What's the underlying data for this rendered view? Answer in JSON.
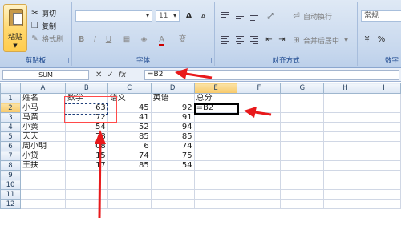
{
  "ribbon": {
    "clipboard": {
      "paste_label": "粘贴",
      "cut_label": "剪切",
      "copy_label": "复制",
      "format_painter_label": "格式刷",
      "group_label": "剪贴板"
    },
    "font": {
      "font_name": "",
      "font_size": "11",
      "grow_font": "A",
      "shrink_font": "A",
      "bold": "B",
      "italic": "I",
      "underline": "U",
      "font_color": "A",
      "phonetic": "变",
      "group_label": "字体"
    },
    "alignment": {
      "wrap_text_label": "自动换行",
      "merge_center_label": "合并后居中",
      "group_label": "对齐方式"
    },
    "number": {
      "format_value": "常规",
      "group_label": "数字"
    }
  },
  "formula_bar": {
    "name_box": "SUM",
    "cancel": "✕",
    "enter": "✓",
    "fx": "fx",
    "formula": "=B2"
  },
  "grid": {
    "columns": [
      "A",
      "B",
      "C",
      "D",
      "E",
      "F",
      "G",
      "H",
      "I"
    ],
    "rows": [
      [
        "1",
        "姓名",
        "数学",
        "语文",
        "英语",
        "总分"
      ],
      [
        "2",
        "小马",
        "63",
        "45",
        "92",
        "=B2"
      ],
      [
        "3",
        "马黄",
        "72",
        "41",
        "91",
        ""
      ],
      [
        "4",
        "小黄",
        "54",
        "52",
        "94",
        ""
      ],
      [
        "5",
        "天天",
        "78",
        "85",
        "85",
        ""
      ],
      [
        "6",
        "周小明",
        "08",
        "6",
        "74",
        ""
      ],
      [
        "7",
        "小贷",
        "15",
        "74",
        "75",
        ""
      ],
      [
        "8",
        "王扶",
        "17",
        "85",
        "54",
        ""
      ],
      [
        "9",
        "",
        "",
        "",
        "",
        ""
      ],
      [
        "10",
        "",
        "",
        "",
        "",
        ""
      ],
      [
        "11",
        "",
        "",
        "",
        "",
        ""
      ],
      [
        "12",
        "",
        "",
        "",
        "",
        ""
      ]
    ]
  },
  "colors": {
    "annotation_red": "#e8191b",
    "ribbon_blue": "#15428b"
  }
}
